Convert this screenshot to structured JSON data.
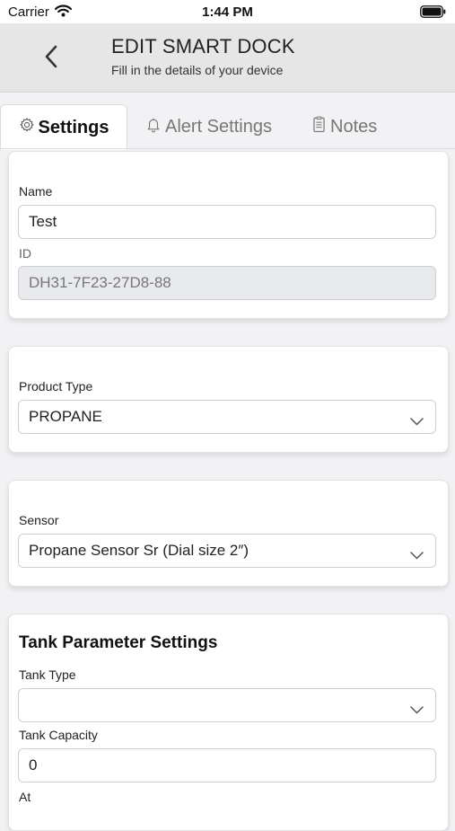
{
  "status_bar": {
    "carrier": "Carrier",
    "time": "1:44 PM"
  },
  "header": {
    "title": "EDIT SMART DOCK",
    "subtitle": "Fill in the details of your device"
  },
  "tabs": [
    {
      "label": "Settings",
      "icon": "gear-icon",
      "active": true
    },
    {
      "label": "Alert Settings",
      "icon": "bell-icon",
      "active": false
    },
    {
      "label": "Notes",
      "icon": "notes-icon",
      "active": false
    }
  ],
  "device": {
    "name_label": "Name",
    "name_value": "Test",
    "id_label": "ID",
    "id_value": "DH31-7F23-27D8-88"
  },
  "product": {
    "label": "Product Type",
    "value": "PROPANE"
  },
  "sensor": {
    "label": "Sensor",
    "value": "Propane Sensor Sr (Dial size 2″)"
  },
  "tank": {
    "title": "Tank Parameter Settings",
    "type_label": "Tank Type",
    "type_value": "",
    "capacity_label": "Tank Capacity",
    "capacity_value": "0",
    "at_label": "At"
  },
  "colors": {
    "accent": "#111111",
    "header_bg": "#e6e6e6",
    "page_bg": "#f2f2f4"
  }
}
